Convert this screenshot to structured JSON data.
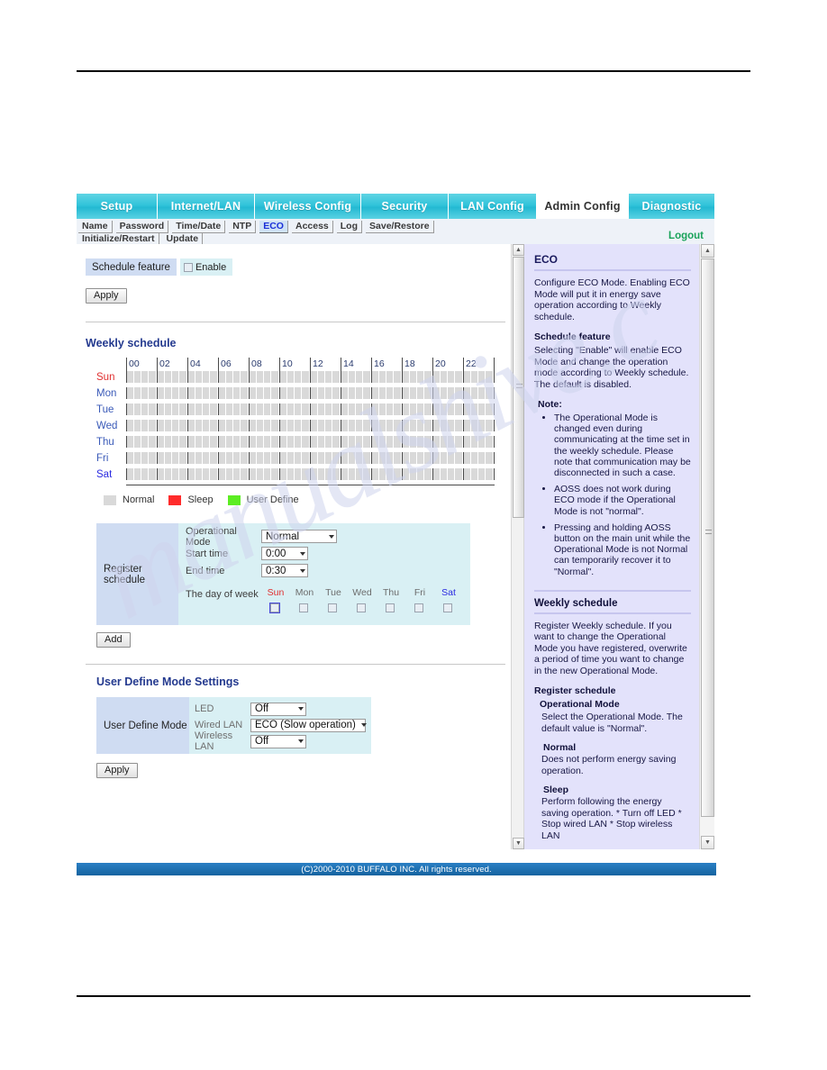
{
  "main_tabs": [
    {
      "label": "Setup",
      "active": false
    },
    {
      "label": "Internet/LAN",
      "active": false
    },
    {
      "label": "Wireless Config",
      "active": false
    },
    {
      "label": "Security",
      "active": false
    },
    {
      "label": "LAN Config",
      "active": false
    },
    {
      "label": "Admin Config",
      "active": true
    },
    {
      "label": "Diagnostic",
      "active": false
    }
  ],
  "sub_tabs_row1": [
    "Name",
    "Password",
    "Time/Date",
    "NTP",
    "ECO",
    "Access",
    "Log",
    "Save/Restore"
  ],
  "sub_tabs_row2": [
    "Initialize/Restart",
    "Update"
  ],
  "active_sub_tab": "ECO",
  "logout_label": "Logout",
  "schedule_feature": {
    "label": "Schedule feature",
    "enable_label": "Enable",
    "enabled": false,
    "apply_label": "Apply"
  },
  "weekly_schedule": {
    "title": "Weekly schedule",
    "hour_labels": [
      "00",
      "02",
      "04",
      "06",
      "08",
      "10",
      "12",
      "14",
      "16",
      "18",
      "20",
      "22"
    ],
    "days": [
      "Sun",
      "Mon",
      "Tue",
      "Wed",
      "Thu",
      "Fri",
      "Sat"
    ],
    "legend": [
      {
        "label": "Normal",
        "color": "#d9d9d9"
      },
      {
        "label": "Sleep",
        "color": "#ff2b2b"
      },
      {
        "label": "User Define",
        "color": "#5ced22"
      }
    ]
  },
  "register_schedule": {
    "row_label": "Register schedule",
    "operational_mode_label": "Operational Mode",
    "operational_mode_value": "Normal",
    "start_time_label": "Start time",
    "start_time_value": "0:00",
    "end_time_label": "End time",
    "end_time_value": "0:30",
    "day_of_week_label": "The day of week",
    "days": [
      "Sun",
      "Mon",
      "Tue",
      "Wed",
      "Thu",
      "Fri",
      "Sat"
    ],
    "add_label": "Add"
  },
  "user_define": {
    "title": "User Define Mode Settings",
    "row_label": "User Define Mode",
    "led_label": "LED",
    "led_value": "Off",
    "wired_lan_label": "Wired LAN",
    "wired_lan_value": "ECO (Slow operation)",
    "wireless_lan_label": "Wireless LAN",
    "wireless_lan_value": "Off",
    "apply_label": "Apply"
  },
  "help": {
    "title": "ECO",
    "intro": "Configure ECO Mode. Enabling ECO Mode will put it in energy save operation according to Weekly schedule.",
    "schedule_feature_heading": "Schedule feature",
    "schedule_feature_text": "Selecting \"Enable\" will enable ECO Mode and change the operation mode according to Weekly schedule. The default is disabled.",
    "note_heading": "Note:",
    "notes": [
      "The Operational Mode is changed even during communicating at the time set in the weekly schedule. Please note that communication may be disconnected in such a case.",
      "AOSS does not work during ECO mode if the Operational Mode is not \"normal\".",
      "Pressing and holding AOSS button on the main unit while the Operational Mode is not Normal can temporarily recover it to \"Normal\"."
    ],
    "weekly_heading": "Weekly schedule",
    "weekly_text": "Register Weekly schedule. If you want to change the Operational Mode you have registered, overwrite a period of time you want to change in the new Operational Mode.",
    "register_heading": "Register schedule",
    "op_mode_heading": "Operational Mode",
    "op_mode_text": "Select the Operational Mode. The default value is \"Normal\".",
    "normal_heading": "Normal",
    "normal_text": "Does not perform energy saving operation.",
    "sleep_heading": "Sleep",
    "sleep_text": "Perform following the energy saving operation. * Turn off LED * Stop wired LAN * Stop wireless LAN"
  },
  "footer": "(C)2000-2010 BUFFALO INC. All rights reserved.",
  "watermark": "manualshive.c"
}
